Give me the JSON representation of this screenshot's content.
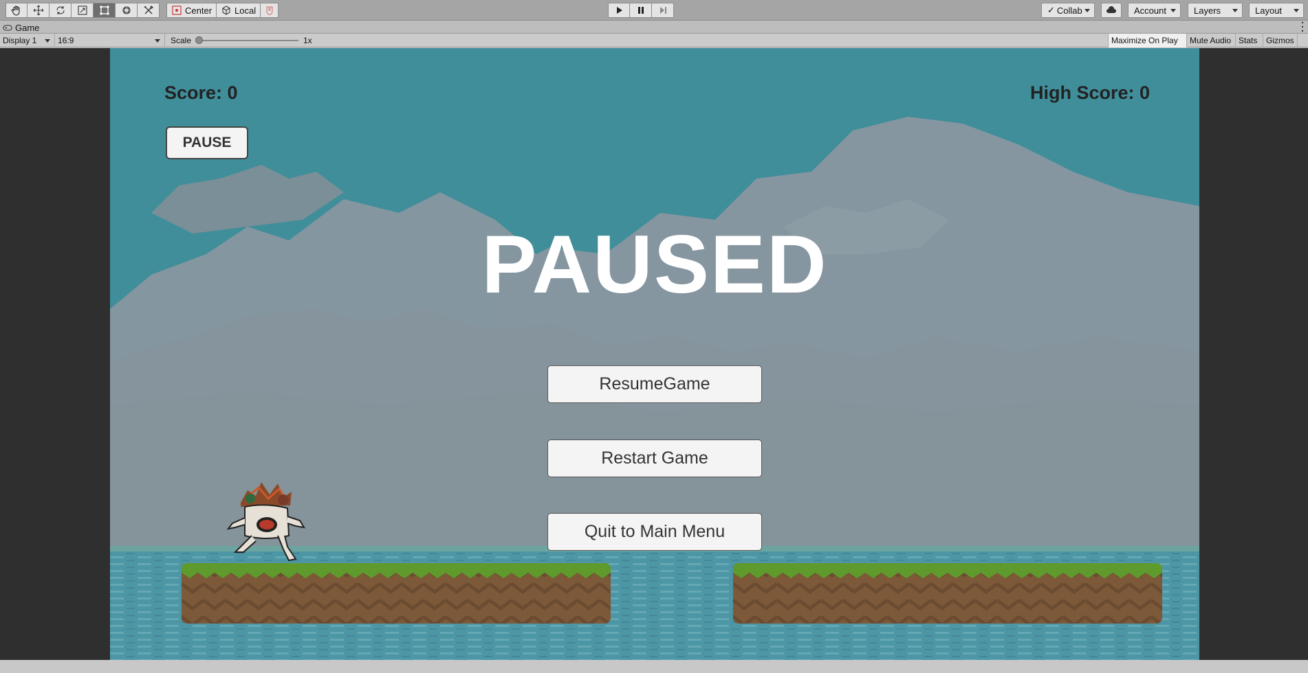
{
  "toolbar": {
    "tools": [
      "hand-tool",
      "move-tool",
      "rotate-tool",
      "scale-tool",
      "rect-tool",
      "transform-tool",
      "custom-tool"
    ],
    "pivot_label": "Center",
    "space_label": "Local",
    "collab_label": "Collab",
    "account_label": "Account",
    "layers_label": "Layers",
    "layout_label": "Layout"
  },
  "tab": {
    "title": "Game"
  },
  "viewbar": {
    "display": "Display 1",
    "aspect": "16:9",
    "scale_label": "Scale",
    "scale_value": "1x",
    "maximize": "Maximize On Play",
    "mute": "Mute Audio",
    "stats": "Stats",
    "gizmos": "Gizmos"
  },
  "game": {
    "score": "Score: 0",
    "high_score": "High Score: 0",
    "pause_button": "PAUSE",
    "paused_title": "PAUSED",
    "resume_button": "ResumeGame",
    "restart_button": "Restart Game",
    "quit_button": "Quit to Main Menu"
  },
  "colors": {
    "sky": "#2a98a8",
    "cloud": "#8aa4b0",
    "grass": "#5f9a2c",
    "dirt": "#7a5a3a",
    "water": "#3aa0b8"
  }
}
